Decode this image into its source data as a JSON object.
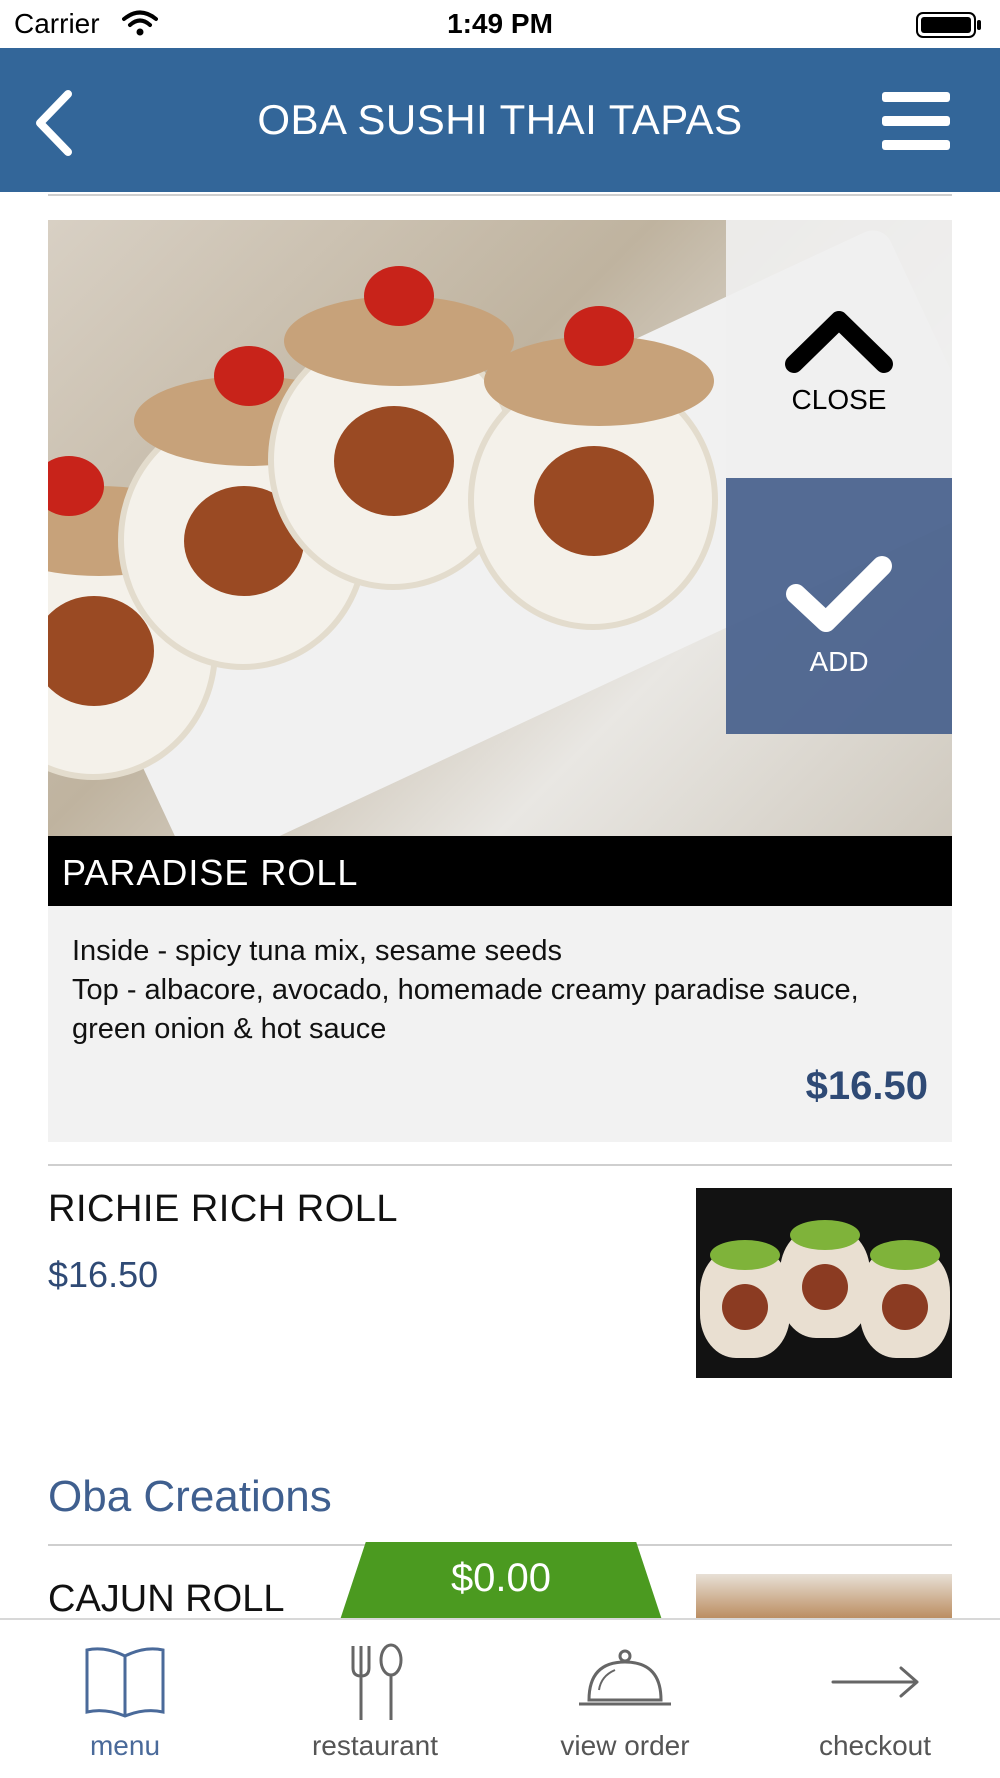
{
  "status_bar": {
    "carrier": "Carrier",
    "time": "1:49 PM"
  },
  "nav": {
    "title": "OBA SUSHI THAI TAPAS",
    "back_icon": "chevron-left-icon",
    "menu_icon": "hamburger-icon"
  },
  "expanded_item": {
    "name": "PARADISE ROLL",
    "description": "Inside - spicy tuna mix, sesame seeds\nTop - albacore, avocado, homemade creamy paradise sauce, green onion & hot sauce",
    "price": "$16.50",
    "close_label": "CLOSE",
    "add_label": "ADD"
  },
  "list_items": [
    {
      "name": "RICHIE RICH ROLL",
      "price": "$16.50"
    }
  ],
  "section": {
    "title": "Oba Creations"
  },
  "partial_item": {
    "name": "CAJUN ROLL"
  },
  "cart": {
    "total": "$0.00"
  },
  "tabs": [
    {
      "label": "menu",
      "icon": "book-icon"
    },
    {
      "label": "restaurant",
      "icon": "fork-spoon-icon"
    },
    {
      "label": "view order",
      "icon": "cloche-icon"
    },
    {
      "label": "checkout",
      "icon": "arrow-right-icon"
    }
  ],
  "colors": {
    "nav_bg": "#336699",
    "add_bg": "#46608c",
    "price": "#2f4a75",
    "cart": "#4b9a20",
    "section": "#3f5f8f"
  }
}
